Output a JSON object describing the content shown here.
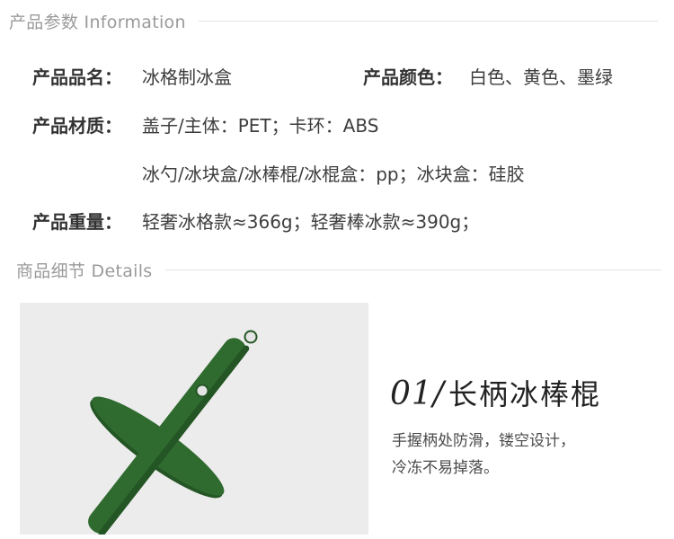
{
  "info_section": {
    "title": "产品参数 Information"
  },
  "specs": {
    "name_label": "产品品名：",
    "name_value": "冰格制冰盒",
    "color_label": "产品颜色：",
    "color_value": "白色、黄色、墨绿",
    "material_label": "产品材质：",
    "material_line1": "盖子/主体：PET；卡环：ABS",
    "material_line2": "冰勺/冰块盒/冰棒棍/冰棍盒：pp；冰块盒：硅胶",
    "weight_label": "产品重量：",
    "weight_value": "轻奢冰格款≈366g；轻奢棒冰款≈390g；"
  },
  "details_section": {
    "title": "商品细节 Details"
  },
  "feature": {
    "number": "01/",
    "name": "长柄冰棒棍",
    "desc_line1": "手握柄处防滑，镂空设计，",
    "desc_line2": "冷冻不易掉落。"
  },
  "colors": {
    "stick_green": "#2f6a2f",
    "stick_green_dark": "#245524",
    "photo_bg": "#ececec"
  }
}
